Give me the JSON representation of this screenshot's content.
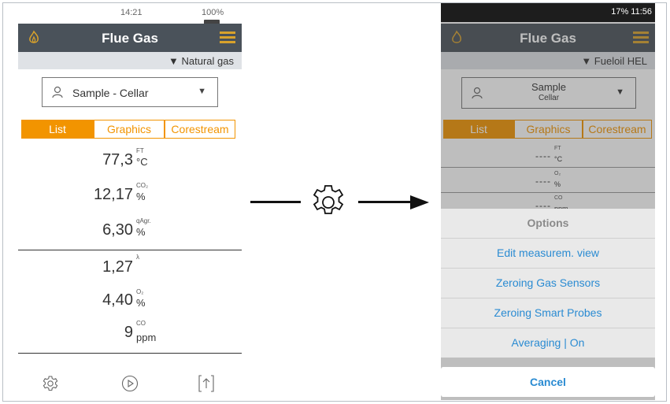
{
  "left": {
    "status": {
      "time": "14:21",
      "battery": "100%"
    },
    "header": {
      "title": "Flue Gas"
    },
    "fuel": {
      "label": "▼ Natural gas"
    },
    "sample": {
      "label": "Sample - Cellar",
      "arrow": "▼"
    },
    "tabs": [
      "List",
      "Graphics",
      "Corestream"
    ],
    "values": [
      {
        "value": "77,3",
        "param": "FT",
        "unit": "°C"
      },
      {
        "value": "12,17",
        "param": "CO₂",
        "unit": "%"
      },
      {
        "value": "6,30",
        "param": "qAgr.",
        "unit": "%"
      },
      {
        "value": "1,27",
        "param": "λ",
        "unit": ""
      },
      {
        "value": "4,40",
        "param": "O₂",
        "unit": "%"
      },
      {
        "value": "9",
        "param": "CO",
        "unit": "ppm"
      }
    ]
  },
  "right": {
    "status": {
      "text": "17%  11:56"
    },
    "header": {
      "title": "Flue Gas"
    },
    "fuel": {
      "label": "▼ Fueloil HEL"
    },
    "sample": {
      "line1": "Sample",
      "line2": "Cellar",
      "arrow": "▼"
    },
    "tabs": [
      "List",
      "Graphics",
      "Corestream"
    ],
    "bg_rows": [
      {
        "dash": "----",
        "param": "FT",
        "unit": "°C"
      },
      {
        "dash": "----",
        "param": "O₂",
        "unit": "%"
      },
      {
        "dash": "----",
        "param": "CO",
        "unit": "ppm"
      }
    ],
    "options": {
      "title": "Options",
      "items": [
        "Edit measurem. view",
        "Zeroing Gas Sensors",
        "Zeroing Smart Probes",
        "Averaging | On"
      ],
      "cancel": "Cancel"
    }
  },
  "colors": {
    "accent": "#f29400",
    "header": "#4a525a",
    "link": "#2a8bd2"
  }
}
